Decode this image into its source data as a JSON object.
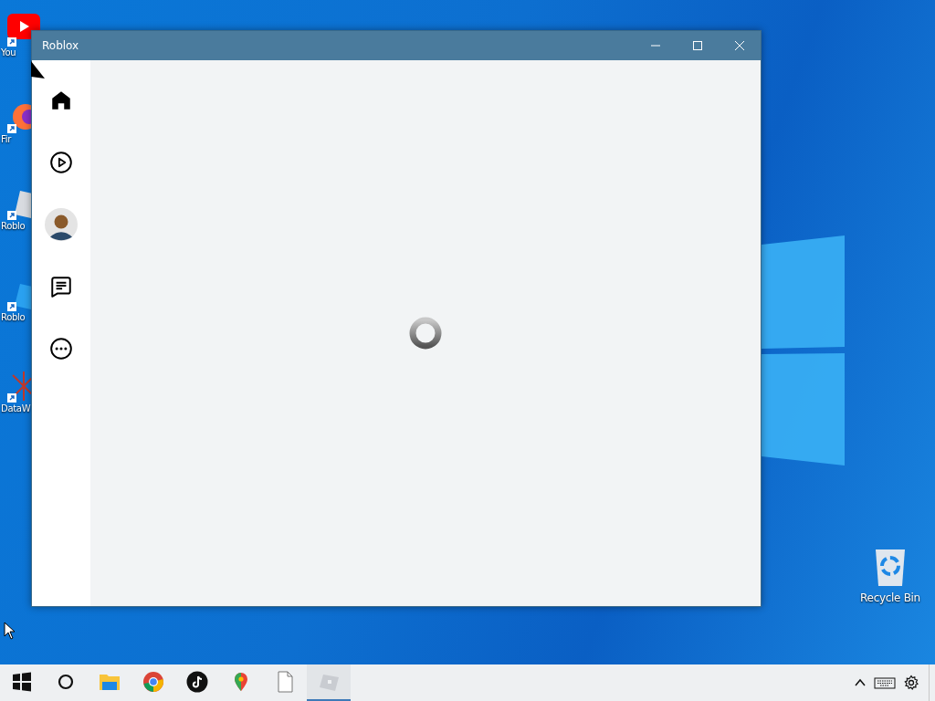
{
  "desktop_icons": [
    {
      "kind": "youtube",
      "label": "You"
    },
    {
      "kind": "firefox",
      "label": "Fir"
    },
    {
      "kind": "roblox",
      "label": "Roblo"
    },
    {
      "kind": "studio",
      "label": "Roblo"
    },
    {
      "kind": "dataviz",
      "label": "DataW"
    }
  ],
  "recycle_bin": {
    "label": "Recycle Bin"
  },
  "window": {
    "title": "Roblox",
    "sidebar": {
      "items": [
        {
          "kind": "home",
          "selected": true
        },
        {
          "kind": "play",
          "selected": false
        },
        {
          "kind": "avatar",
          "selected": false
        },
        {
          "kind": "chat",
          "selected": false
        },
        {
          "kind": "more",
          "selected": false
        }
      ]
    },
    "content": {
      "loading": true
    }
  },
  "taskbar": {
    "items": [
      {
        "kind": "start",
        "selected": false
      },
      {
        "kind": "search",
        "selected": false
      },
      {
        "kind": "folder",
        "selected": false
      },
      {
        "kind": "chrome",
        "selected": false
      },
      {
        "kind": "tiktok",
        "selected": false
      },
      {
        "kind": "maps",
        "selected": false
      },
      {
        "kind": "file",
        "selected": false
      },
      {
        "kind": "roblox",
        "selected": true
      }
    ],
    "tray": [
      {
        "kind": "chevron"
      },
      {
        "kind": "keyboard"
      },
      {
        "kind": "gear"
      }
    ]
  }
}
